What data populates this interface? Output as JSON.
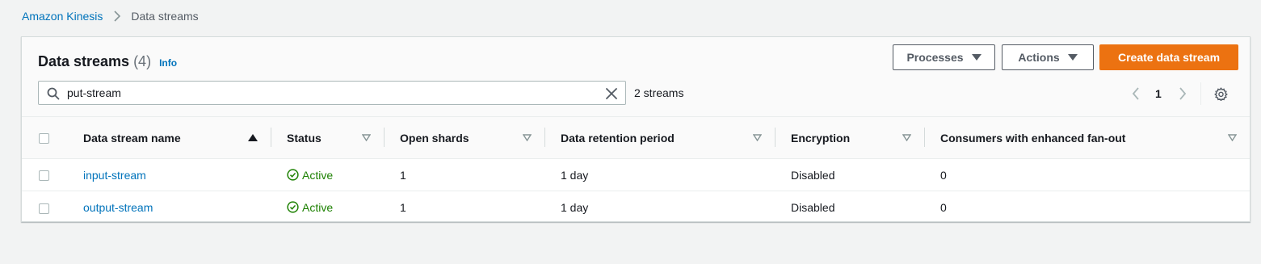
{
  "breadcrumb": {
    "root": "Amazon Kinesis",
    "current": "Data streams"
  },
  "panel": {
    "title": "Data streams",
    "count": "(4)",
    "info": "Info"
  },
  "toolbar": {
    "processes_label": "Processes",
    "actions_label": "Actions",
    "create_label": "Create data stream"
  },
  "search": {
    "value": "put-stream",
    "match_count": "2 streams"
  },
  "pagination": {
    "current_page": "1"
  },
  "table": {
    "columns": [
      "Data stream name",
      "Status",
      "Open shards",
      "Data retention period",
      "Encryption",
      "Consumers with enhanced fan-out"
    ],
    "rows": [
      {
        "name": "input-stream",
        "status": "Active",
        "open_shards": "1",
        "retention": "1 day",
        "encryption": "Disabled",
        "consumers": "0"
      },
      {
        "name": "output-stream",
        "status": "Active",
        "open_shards": "1",
        "retention": "1 day",
        "encryption": "Disabled",
        "consumers": "0"
      }
    ]
  },
  "colors": {
    "link": "#0073bb",
    "primary_button": "#ec7211",
    "status_active": "#1d8102",
    "page_background": "#f2f3f3"
  },
  "icons": {
    "breadcrumb_separator": "chevron-right-icon",
    "search": "search-icon",
    "clear": "close-icon",
    "dropdown": "caret-down-icon",
    "sort_active": "sort-ascending-icon",
    "sort_inactive": "sort-icon",
    "status": "check-circle-icon",
    "settings": "gear-icon"
  }
}
